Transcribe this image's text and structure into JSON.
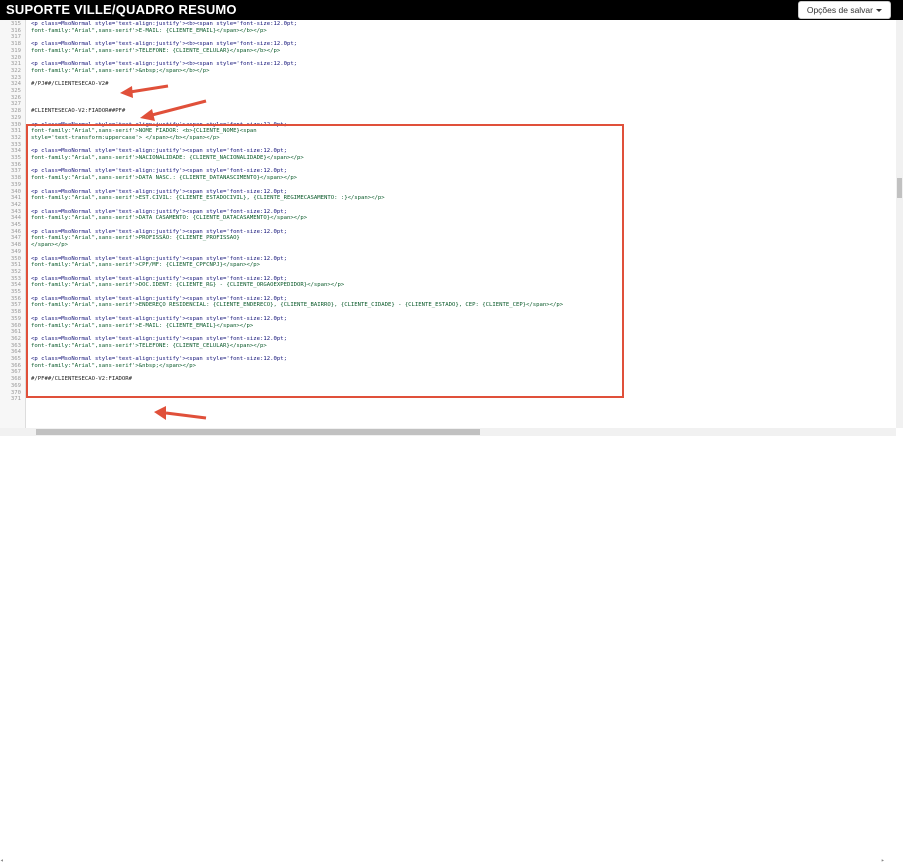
{
  "app": {
    "title": "SUPORTE VILLE/QUADRO RESUMO",
    "save_button_label": "Opções de salvar",
    "colors": {
      "topbar": "#000000",
      "highlight": "#e0503a",
      "arrow": "#e0503a"
    }
  },
  "editor": {
    "lines": [
      {
        "n": "315",
        "t": "<p class=MsoNormal style='text-align:justify'><b><span style='font-size:12.0pt;"
      },
      {
        "n": "316",
        "t": "font-family:\"Arial\",sans-serif'>E-MAIL: {CLIENTE_EMAIL}</span></b></p>"
      },
      {
        "n": "317",
        "t": ""
      },
      {
        "n": "318",
        "t": "<p class=MsoNormal style='text-align:justify'><b><span style='font-size:12.0pt;"
      },
      {
        "n": "319",
        "t": "font-family:\"Arial\",sans-serif'>TELEFONE: {CLIENTE_CELULAR}</span></b></p>"
      },
      {
        "n": "320",
        "t": ""
      },
      {
        "n": "321",
        "t": "<p class=MsoNormal style='text-align:justify'><b><span style='font-size:12.0pt;"
      },
      {
        "n": "322",
        "t": "font-family:\"Arial\",sans-serif'>&nbsp;</span></b></p>"
      },
      {
        "n": "323",
        "t": ""
      },
      {
        "n": "324",
        "t": "#/PJ##/CLIENTESECAO-V2#"
      },
      {
        "n": "325",
        "t": ""
      },
      {
        "n": "326",
        "t": ""
      },
      {
        "n": "327",
        "t": ""
      },
      {
        "n": "328",
        "t": "#CLIENTESECAO-V2:FIADOR##PF#"
      },
      {
        "n": "329",
        "t": ""
      },
      {
        "n": "330",
        "t": "<p class=MsoNormal style='text-align:justify'><span style='font-size:12.0pt;"
      },
      {
        "n": "331",
        "t": "font-family:\"Arial\",sans-serif'>NOME FIADOR: <b>{CLIENTE_NOME}<span"
      },
      {
        "n": "332",
        "t": "style='text-transform:uppercase'> </span></b></span></p>"
      },
      {
        "n": "333",
        "t": ""
      },
      {
        "n": "334",
        "t": "<p class=MsoNormal style='text-align:justify'><span style='font-size:12.0pt;"
      },
      {
        "n": "335",
        "t": "font-family:\"Arial\",sans-serif'>NACIONALIDADE: {CLIENTE_NACIONALIDADE}</span></p>"
      },
      {
        "n": "336",
        "t": ""
      },
      {
        "n": "337",
        "t": "<p class=MsoNormal style='text-align:justify'><span style='font-size:12.0pt;"
      },
      {
        "n": "338",
        "t": "font-family:\"Arial\",sans-serif'>DATA NASC.: {CLIENTE_DATANASCIMENTO}</span></p>"
      },
      {
        "n": "339",
        "t": ""
      },
      {
        "n": "340",
        "t": "<p class=MsoNormal style='text-align:justify'><span style='font-size:12.0pt;"
      },
      {
        "n": "341",
        "t": "font-family:\"Arial\",sans-serif'>EST.CIVIL: {CLIENTE_ESTADOCIVIL}, {CLIENTE_REGIMECASAMENTO: :}</span></p>"
      },
      {
        "n": "342",
        "t": ""
      },
      {
        "n": "343",
        "t": "<p class=MsoNormal style='text-align:justify'><span style='font-size:12.0pt;"
      },
      {
        "n": "344",
        "t": "font-family:\"Arial\",sans-serif'>DATA CASAMENTO: {CLIENTE_DATACASAMENTO}</span></p>"
      },
      {
        "n": "345",
        "t": ""
      },
      {
        "n": "346",
        "t": "<p class=MsoNormal style='text-align:justify'><span style='font-size:12.0pt;"
      },
      {
        "n": "347",
        "t": "font-family:\"Arial\",sans-serif'>PROFISSÃO: {CLIENTE_PROFISSAO}"
      },
      {
        "n": "348",
        "t": "</span></p>"
      },
      {
        "n": "349",
        "t": ""
      },
      {
        "n": "350",
        "t": "<p class=MsoNormal style='text-align:justify'><span style='font-size:12.0pt;"
      },
      {
        "n": "351",
        "t": "font-family:\"Arial\",sans-serif'>CPF/MF: {CLIENTE_CPFCNPJ}</span></p>"
      },
      {
        "n": "352",
        "t": ""
      },
      {
        "n": "353",
        "t": "<p class=MsoNormal style='text-align:justify'><span style='font-size:12.0pt;"
      },
      {
        "n": "354",
        "t": "font-family:\"Arial\",sans-serif'>DOC.IDENT: {CLIENTE_RG} - {CLIENTE_ORGAOEXPEDIDOR}</span></p>"
      },
      {
        "n": "355",
        "t": ""
      },
      {
        "n": "356",
        "t": "<p class=MsoNormal style='text-align:justify'><span style='font-size:12.0pt;"
      },
      {
        "n": "357",
        "t": "font-family:\"Arial\",sans-serif'>ENDEREÇO RESIDENCIAL: {CLIENTE_ENDERECO}, {CLIENTE_BAIRRO}, {CLIENTE_CIDADE} - {CLIENTE_ESTADO}, CEP: {CLIENTE_CEP}</span></p>"
      },
      {
        "n": "358",
        "t": ""
      },
      {
        "n": "359",
        "t": "<p class=MsoNormal style='text-align:justify'><span style='font-size:12.0pt;"
      },
      {
        "n": "360",
        "t": "font-family:\"Arial\",sans-serif'>E-MAIL: {CLIENTE_EMAIL}</span></p>"
      },
      {
        "n": "361",
        "t": ""
      },
      {
        "n": "362",
        "t": "<p class=MsoNormal style='text-align:justify'><span style='font-size:12.0pt;"
      },
      {
        "n": "363",
        "t": "font-family:\"Arial\",sans-serif'>TELEFONE: {CLIENTE_CELULAR}</span></p>"
      },
      {
        "n": "364",
        "t": ""
      },
      {
        "n": "365",
        "t": "<p class=MsoNormal style='text-align:justify'><span style='font-size:12.0pt;"
      },
      {
        "n": "366",
        "t": "font-family:\"Arial\",sans-serif'>&nbsp;</span></p>"
      },
      {
        "n": "367",
        "t": ""
      },
      {
        "n": "368",
        "t": "#/PF##/CLIENTESECAO-V2:FIADOR#"
      },
      {
        "n": "369",
        "t": ""
      },
      {
        "n": "370",
        "t": ""
      },
      {
        "n": "371",
        "t": ""
      }
    ]
  }
}
